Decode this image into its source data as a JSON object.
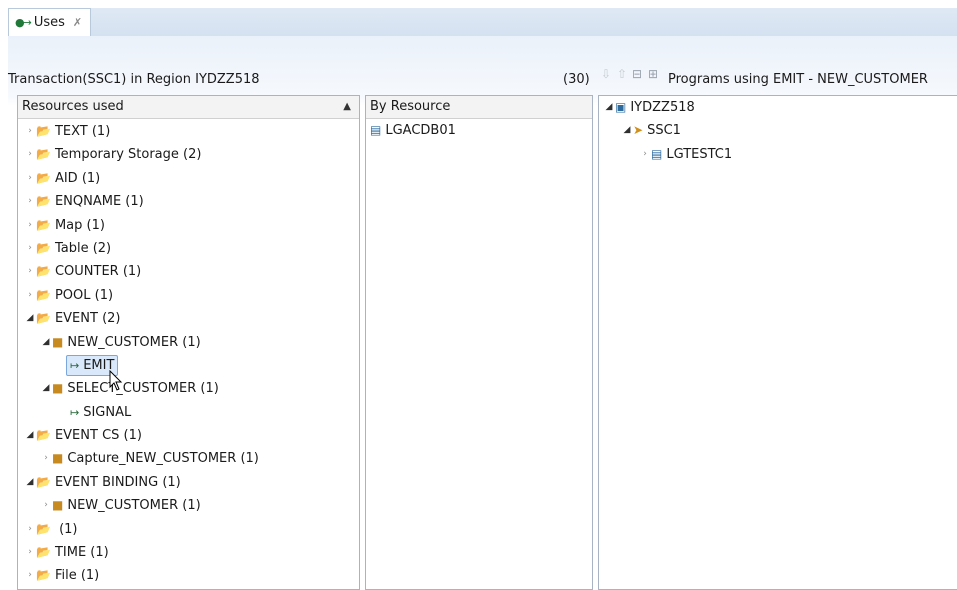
{
  "tab": {
    "label": "Uses",
    "close": "✗"
  },
  "header": {
    "left": "Transaction(SSC1) in Region IYDZZ518",
    "count": "(30)",
    "right_title": "Programs using EMIT - NEW_CUSTOMER"
  },
  "panels": {
    "resources": {
      "header": "Resources used",
      "items": [
        {
          "label": "TEXT  (1)"
        },
        {
          "label": "Temporary Storage  (2)"
        },
        {
          "label": "AID  (1)"
        },
        {
          "label": "ENQNAME  (1)"
        },
        {
          "label": "Map  (1)"
        },
        {
          "label": "Table  (2)"
        },
        {
          "label": "COUNTER  (1)"
        },
        {
          "label": "POOL  (1)"
        },
        {
          "label": "EVENT  (2)"
        },
        {
          "label": "NEW_CUSTOMER (1)"
        },
        {
          "label": "EMIT"
        },
        {
          "label": "SELECT_CUSTOMER (1)"
        },
        {
          "label": "SIGNAL"
        },
        {
          "label": "EVENT CS  (1)"
        },
        {
          "label": "Capture_NEW_CUSTOMER (1)"
        },
        {
          "label": "EVENT BINDING  (1)"
        },
        {
          "label": "NEW_CUSTOMER (1)"
        },
        {
          "label": " (1)"
        },
        {
          "label": "TIME  (1)"
        },
        {
          "label": "File  (1)"
        }
      ]
    },
    "by_resource": {
      "header": "By Resource",
      "items": [
        {
          "label": "LGACDB01"
        }
      ]
    },
    "programs": {
      "items": [
        {
          "label": "IYDZZ518"
        },
        {
          "label": "SSC1"
        },
        {
          "label": "LGTESTC1"
        }
      ]
    }
  },
  "icons": {
    "folder": "📂",
    "arrow_collapsed": "›",
    "arrow_expanded": "◢"
  },
  "colors": {
    "selection": "#d9e8fb",
    "selection_border": "#7aa7dd",
    "tab_bar": "#d4e1f0"
  }
}
